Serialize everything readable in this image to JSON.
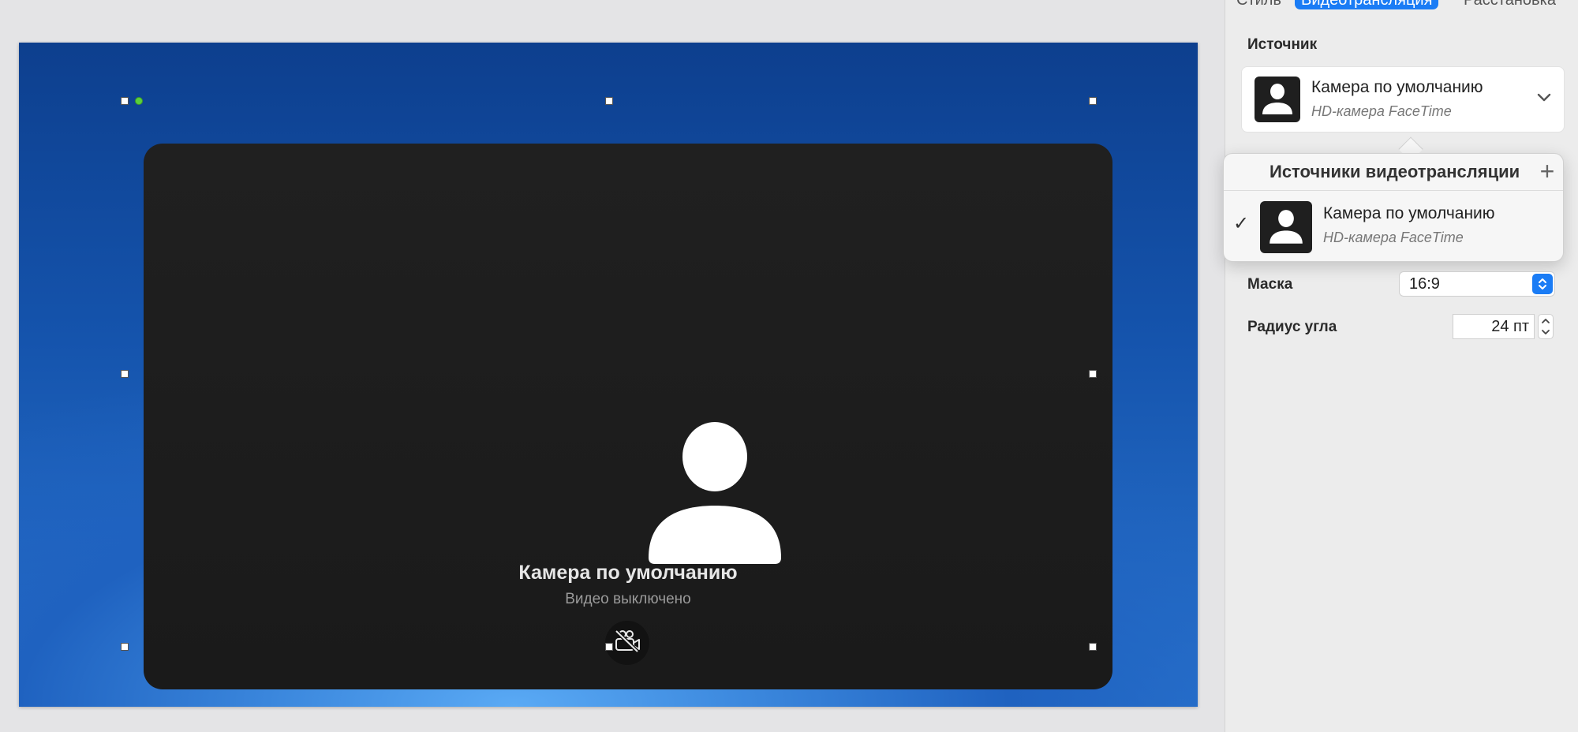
{
  "inspector": {
    "tabs": [
      {
        "label": "Стиль",
        "active": false
      },
      {
        "label": "Видеотрансляция",
        "active": true
      },
      {
        "label": "Расстановка",
        "active": false
      }
    ],
    "source_label": "Источник",
    "selected_source": {
      "name": "Камера по умолчанию",
      "device": "HD-камера FaceTime"
    },
    "popover": {
      "title": "Источники видеотрансляции",
      "add_symbol": "+",
      "items": [
        {
          "name": "Камера по умолчанию",
          "device": "HD-камера FaceTime",
          "checked": true,
          "check_symbol": "✓"
        }
      ]
    },
    "mask_label": "Маска",
    "mask_value": "16:9",
    "corner_radius_label": "Радиус угла",
    "corner_radius_value": "24 пт"
  },
  "canvas": {
    "video": {
      "title": "Камера по умолчанию",
      "status": "Видео выключено",
      "button_icon": "camera-off-icon"
    }
  },
  "colors": {
    "accent": "#1a7cf5",
    "selection_dot": "#5ad03c",
    "video_bg": "#1c1c1c"
  }
}
